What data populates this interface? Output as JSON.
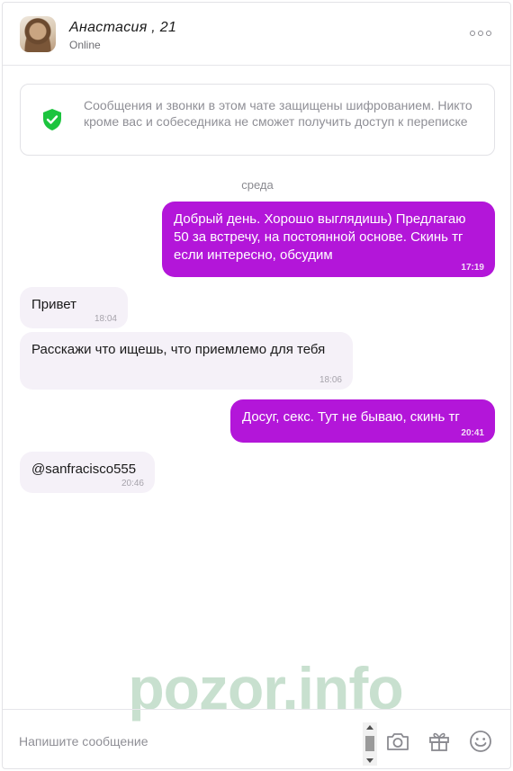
{
  "header": {
    "name": "Анастасия , 21",
    "status": "Online",
    "more_icon": "more-horizontal-icon"
  },
  "notice": {
    "icon": "shield-check-icon",
    "text": "Сообщения и звонки в этом чате защищены шифрованием. Никто кроме вас и собеседника не сможет получить доступ к переписке"
  },
  "day_label": "среда",
  "messages": [
    {
      "direction": "out",
      "text": "Добрый день. Хорошо выглядишь) Предлагаю 50 за встречу, на постоянной основе. Скинь тг если интересно, обсудим",
      "time": "17:19"
    },
    {
      "direction": "in",
      "text": "Привет",
      "time": "18:04"
    },
    {
      "direction": "in",
      "text": "Расскажи что ищешь, что приемлемо для тебя",
      "time": "18:06"
    },
    {
      "direction": "out",
      "text": "Досуг, секс. Тут не бываю, скинь тг",
      "time": "20:41"
    },
    {
      "direction": "in",
      "text": "@sanfracisco555",
      "time": "20:46"
    }
  ],
  "watermark": "pozor.info",
  "composer": {
    "placeholder": "Напишите сообщение",
    "value": "",
    "tools": [
      "camera-icon",
      "gift-icon",
      "smile-icon"
    ]
  },
  "colors": {
    "outgoing_bubble": "#b316d9",
    "incoming_bubble": "#f5f1f8",
    "shield": "#1cc43e",
    "watermark": "#c8e0cf"
  }
}
